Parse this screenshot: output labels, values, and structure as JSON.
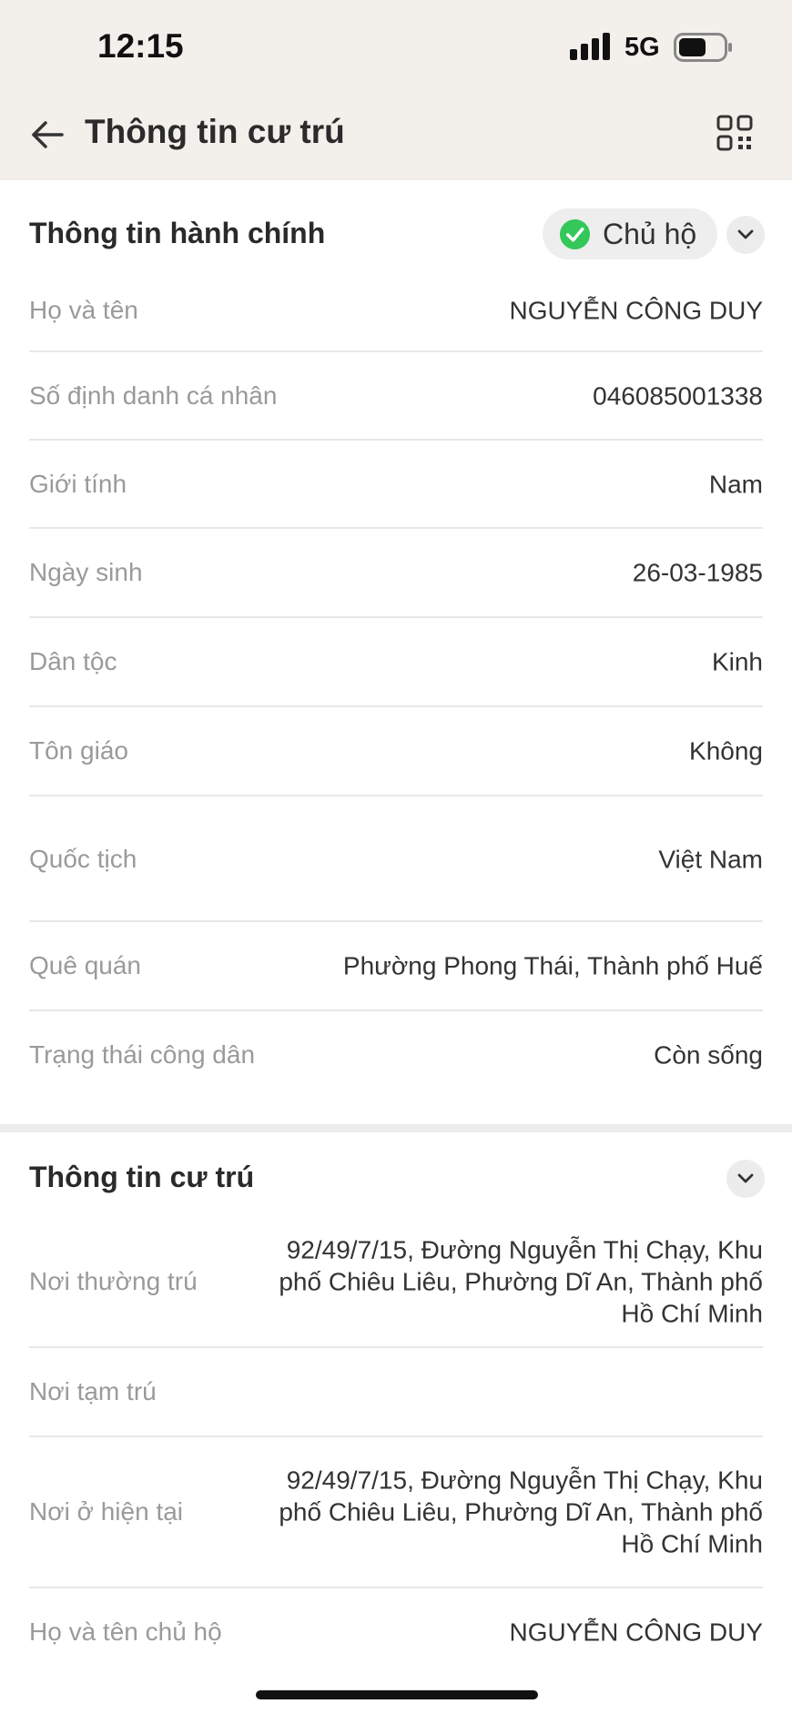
{
  "status_bar": {
    "time": "12:15",
    "network": "5G"
  },
  "header": {
    "title": "Thông tin cư trú"
  },
  "admin_section": {
    "title": "Thông tin hành chính",
    "badge": "Chủ hộ",
    "rows": [
      {
        "label": "Họ và tên",
        "value": "NGUYỄN CÔNG DUY"
      },
      {
        "label": "Số định danh cá nhân",
        "value": "046085001338"
      },
      {
        "label": "Giới tính",
        "value": "Nam"
      },
      {
        "label": "Ngày sinh",
        "value": "26-03-1985"
      },
      {
        "label": "Dân tộc",
        "value": "Kinh"
      },
      {
        "label": "Tôn giáo",
        "value": "Không"
      },
      {
        "label": "Quốc tịch",
        "value": "Việt Nam"
      },
      {
        "label": "Quê quán",
        "value": "Phường Phong Thái, Thành phố Huế"
      },
      {
        "label": "Trạng thái công dân",
        "value": "Còn sống"
      }
    ]
  },
  "residence_section": {
    "title": "Thông tin cư trú",
    "rows": [
      {
        "label": "Nơi thường trú",
        "value": "92/49/7/15, Đường Nguyễn Thị Chạy, Khu phố Chiêu Liêu, Phường Dĩ An, Thành phố Hồ Chí Minh"
      },
      {
        "label": "Nơi tạm trú",
        "value": ""
      },
      {
        "label": "Nơi ở hiện tại",
        "value": "92/49/7/15, Đường Nguyễn Thị Chạy, Khu phố Chiêu Liêu, Phường Dĩ An, Thành phố Hồ Chí Minh"
      },
      {
        "label": "Họ và tên chủ hộ",
        "value": "NGUYỄN CÔNG DUY"
      }
    ]
  }
}
